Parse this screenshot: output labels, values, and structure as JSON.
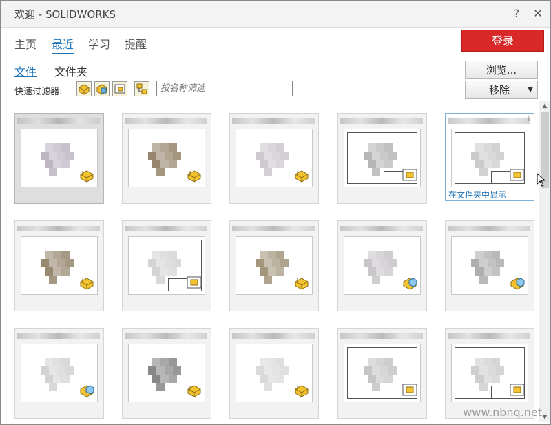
{
  "window": {
    "title": "欢迎 - SOLIDWORKS",
    "help_label": "?",
    "close_label": "✕"
  },
  "nav": {
    "tabs": [
      {
        "label": "主页"
      },
      {
        "label": "最近"
      },
      {
        "label": "学习"
      },
      {
        "label": "提醒"
      }
    ],
    "login_label": "登录"
  },
  "subtabs": {
    "files_label": "文件",
    "folders_label": "文件夹"
  },
  "actions": {
    "browse_label": "浏览...",
    "remove_label": "移除",
    "remove_arrow": "▼"
  },
  "filter": {
    "label": "快速过滤器:",
    "placeholder": "按名称筛选",
    "icons": [
      "part-filter-icon",
      "assembly-filter-icon",
      "drawing-filter-icon",
      "top-level-assembly-filter-icon"
    ]
  },
  "hover_card": {
    "show_in_folder_label": "在文件夹中显示",
    "pin_label": "⊣"
  },
  "cards": [
    {
      "type": "part",
      "kind": "blob",
      "tone": "#b8b0bd"
    },
    {
      "type": "part",
      "kind": "blob",
      "tone": "#8d7a5e"
    },
    {
      "type": "part",
      "kind": "blob",
      "tone": "#c9c2ca"
    },
    {
      "type": "drawing",
      "kind": "drawing",
      "tone": "#b0b0b0"
    },
    {
      "type": "drawing",
      "kind": "drawing",
      "tone": "#c6c6c6"
    },
    {
      "type": "part",
      "kind": "blob",
      "tone": "#8e7d63"
    },
    {
      "type": "drawing",
      "kind": "drawing",
      "tone": "#d0d0d0"
    },
    {
      "type": "part",
      "kind": "blob",
      "tone": "#9a8c70"
    },
    {
      "type": "assembly",
      "kind": "blob",
      "tone": "#c3c0c4"
    },
    {
      "type": "assembly",
      "kind": "blob",
      "tone": "#a6a6a6"
    },
    {
      "type": "assembly",
      "kind": "blob",
      "tone": "#cfcfcf"
    },
    {
      "type": "part",
      "kind": "blob",
      "tone": "#7c7c7c"
    },
    {
      "type": "part",
      "kind": "blob",
      "tone": "#d6d6d6"
    },
    {
      "type": "drawing",
      "kind": "drawing",
      "tone": "#c0c0c0"
    },
    {
      "type": "drawing",
      "kind": "drawing",
      "tone": "#cacaca"
    }
  ],
  "watermark": "www.nbnq.net",
  "colors": {
    "accent": "#1f73b7",
    "login": "#d82828"
  }
}
